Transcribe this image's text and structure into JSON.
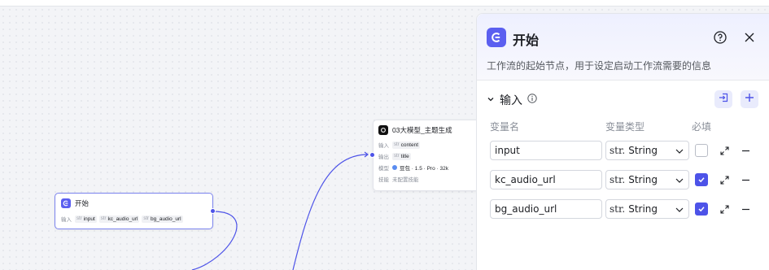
{
  "canvas": {
    "start_node": {
      "title": "开始",
      "input_label": "输入",
      "chips": [
        {
          "type": "str",
          "name": "input"
        },
        {
          "type": "str",
          "name": "kc_audio_url"
        },
        {
          "type": "str",
          "name": "bg_audio_url"
        }
      ]
    },
    "llm_node": {
      "title": "03大模型_主题生成",
      "rows": [
        {
          "label": "输入",
          "type": "str",
          "value": "content"
        },
        {
          "label": "输出",
          "type": "str",
          "value": "title"
        },
        {
          "label": "模型",
          "type": "",
          "value": "豆包 · 1.5 · Pro · 32k"
        },
        {
          "label": "技能",
          "type": "",
          "value": "未配置技能"
        }
      ]
    }
  },
  "panel": {
    "title": "开始",
    "description": "工作流的起始节点，用于设定启动工作流需要的信息",
    "section_title": "输入",
    "columns": {
      "name": "变量名",
      "type": "变量类型",
      "required": "必填"
    },
    "variables": [
      {
        "name": "input",
        "type_tag": "str.",
        "type": "String",
        "required": false
      },
      {
        "name": "kc_audio_url",
        "type_tag": "str.",
        "type": "String",
        "required": true
      },
      {
        "name": "bg_audio_url",
        "type_tag": "str.",
        "type": "String",
        "required": true
      }
    ]
  },
  "colors": {
    "accent": "#4d53e8",
    "app_icon": "#5b5ff0"
  },
  "icons": [
    "workflow-start-icon",
    "help-icon",
    "close-icon",
    "chevron-down-icon",
    "info-icon",
    "import-icon",
    "plus-icon",
    "expand-icon",
    "minus-icon",
    "check-icon"
  ]
}
